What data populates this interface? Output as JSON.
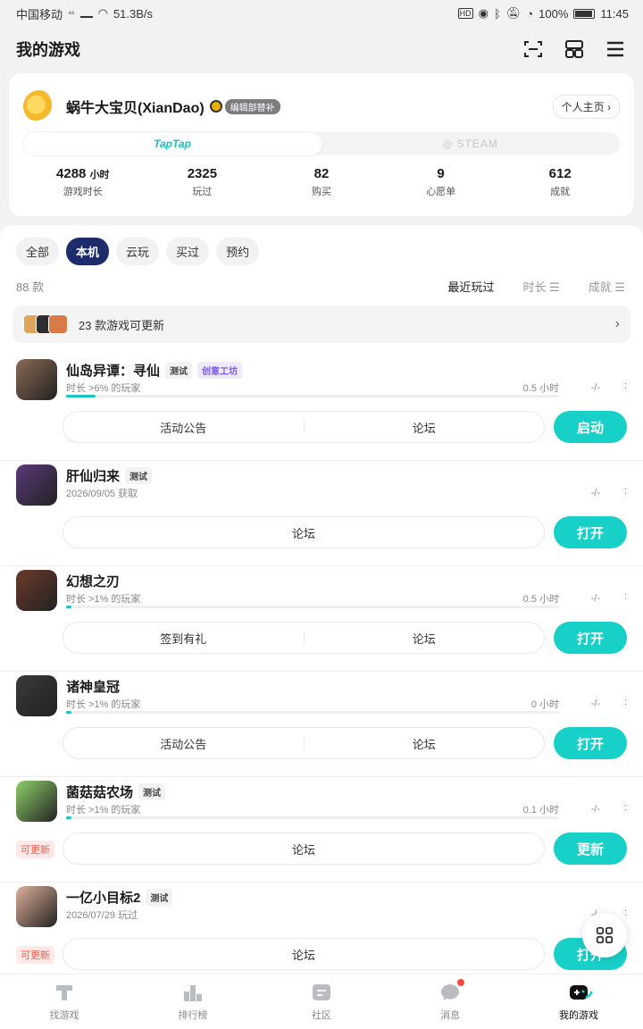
{
  "status_bar": {
    "carrier": "中国移动",
    "net": "⁴⁶",
    "speed": "51.3B/s",
    "battery": "100%",
    "time": "11:45"
  },
  "header": {
    "title": "我的游戏"
  },
  "profile": {
    "username": "蜗牛大宝贝(XianDao)",
    "badge": "编辑部替补",
    "homepage": "个人主页 ›",
    "platform_tabs": [
      "TapTap",
      "STEAM"
    ],
    "stats": [
      {
        "value": "4288",
        "unit": "小时",
        "label": "游戏时长"
      },
      {
        "value": "2325",
        "unit": "",
        "label": "玩过"
      },
      {
        "value": "82",
        "unit": "",
        "label": "购买"
      },
      {
        "value": "9",
        "unit": "",
        "label": "心愿单"
      },
      {
        "value": "612",
        "unit": "",
        "label": "成就"
      }
    ]
  },
  "filters": [
    "全部",
    "本机",
    "云玩",
    "买过",
    "预约"
  ],
  "count": "88 款",
  "sorts": [
    "最近玩过",
    "时长 ☰",
    "成就 ☰"
  ],
  "update_banner": "23 款游戏可更新",
  "games": [
    {
      "name": "仙岛异谭：寻仙",
      "tags": [
        "测试",
        "创意工坊"
      ],
      "sub": "时长 >6% 的玩家",
      "hours": "0.5 小时",
      "progress": 0.06,
      "ach": "-/-",
      "more": ":",
      "links": [
        "活动公告",
        "论坛"
      ],
      "cta": "启动",
      "update": "",
      "icon_color": "#8a6a55"
    },
    {
      "name": "肝仙归来",
      "tags": [
        "测试"
      ],
      "sub": "2026/09/05 获取",
      "hours": "",
      "progress": null,
      "ach": "-/-",
      "more": ":",
      "links": [
        "论坛"
      ],
      "cta": "打开",
      "update": "",
      "icon_color": "#5a3a7a"
    },
    {
      "name": "幻想之刃",
      "tags": [],
      "sub": "时长 >1% 的玩家",
      "hours": "0.5 小时",
      "progress": 0.01,
      "ach": "-/-",
      "more": ":",
      "links": [
        "签到有礼",
        "论坛"
      ],
      "cta": "打开",
      "update": "",
      "icon_color": "#6b3a2a"
    },
    {
      "name": "诸神皇冠",
      "tags": [],
      "sub": "时长 >1% 的玩家",
      "hours": "0 小时",
      "progress": 0.01,
      "ach": "-/-",
      "more": ":",
      "links": [
        "活动公告",
        "论坛"
      ],
      "cta": "打开",
      "update": "",
      "icon_color": "#3a3a3a"
    },
    {
      "name": "菌菇菇农场",
      "tags": [
        "测试"
      ],
      "sub": "时长 >1% 的玩家",
      "hours": "0.1 小时",
      "progress": 0.01,
      "ach": "-/-",
      "more": ":",
      "links": [
        "论坛"
      ],
      "cta": "更新",
      "update": "可更新",
      "icon_color": "#8fcf6a"
    },
    {
      "name": "一亿小目标2",
      "tags": [
        "测试"
      ],
      "sub": "2026/07/29 玩过",
      "hours": "",
      "progress": null,
      "ach": "-/-",
      "more": ":",
      "links": [
        "论坛"
      ],
      "cta": "打开",
      "update": "可更新",
      "icon_color": "#e0b09a"
    }
  ],
  "bottom_nav": [
    "找游戏",
    "排行榜",
    "社区",
    "消息",
    "我的游戏"
  ],
  "colors": {
    "accent": "#17d0c8",
    "filter_active": "#1d2c6b",
    "update_red": "#f25a4a"
  }
}
